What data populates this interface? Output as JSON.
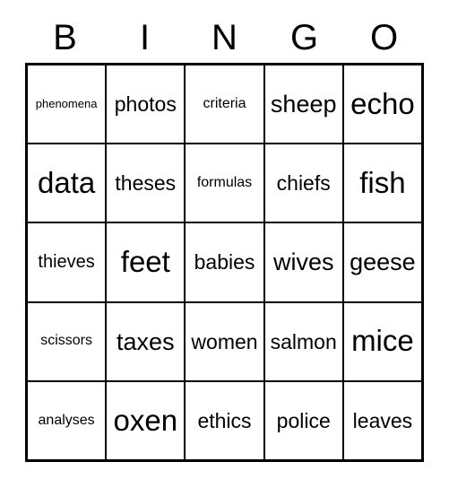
{
  "card": {
    "headers": [
      "B",
      "I",
      "N",
      "G",
      "O"
    ],
    "rows": [
      [
        {
          "text": "phenomena",
          "size_class": "len-9"
        },
        {
          "text": "photos",
          "size_class": "len-6"
        },
        {
          "text": "criteria",
          "size_class": "len-8"
        },
        {
          "text": "sheep",
          "size_class": "len-5"
        },
        {
          "text": "echo",
          "size_class": "len-4"
        }
      ],
      [
        {
          "text": "data",
          "size_class": "len-4"
        },
        {
          "text": "theses",
          "size_class": "len-6"
        },
        {
          "text": "formulas",
          "size_class": "len-8"
        },
        {
          "text": "chiefs",
          "size_class": "len-6"
        },
        {
          "text": "fish",
          "size_class": "len-4"
        }
      ],
      [
        {
          "text": "thieves",
          "size_class": "len-7"
        },
        {
          "text": "feet",
          "size_class": "len-4"
        },
        {
          "text": "babies",
          "size_class": "len-6"
        },
        {
          "text": "wives",
          "size_class": "len-5"
        },
        {
          "text": "geese",
          "size_class": "len-5"
        }
      ],
      [
        {
          "text": "scissors",
          "size_class": "len-8"
        },
        {
          "text": "taxes",
          "size_class": "len-5"
        },
        {
          "text": "women",
          "size_class": "len-6"
        },
        {
          "text": "salmon",
          "size_class": "len-6"
        },
        {
          "text": "mice",
          "size_class": "len-4"
        }
      ],
      [
        {
          "text": "analyses",
          "size_class": "len-8"
        },
        {
          "text": "oxen",
          "size_class": "len-4"
        },
        {
          "text": "ethics",
          "size_class": "len-6"
        },
        {
          "text": "police",
          "size_class": "len-6"
        },
        {
          "text": "leaves",
          "size_class": "len-6"
        }
      ]
    ]
  },
  "colors": {
    "background": "#ffffff",
    "text": "#000000",
    "border": "#000000"
  }
}
